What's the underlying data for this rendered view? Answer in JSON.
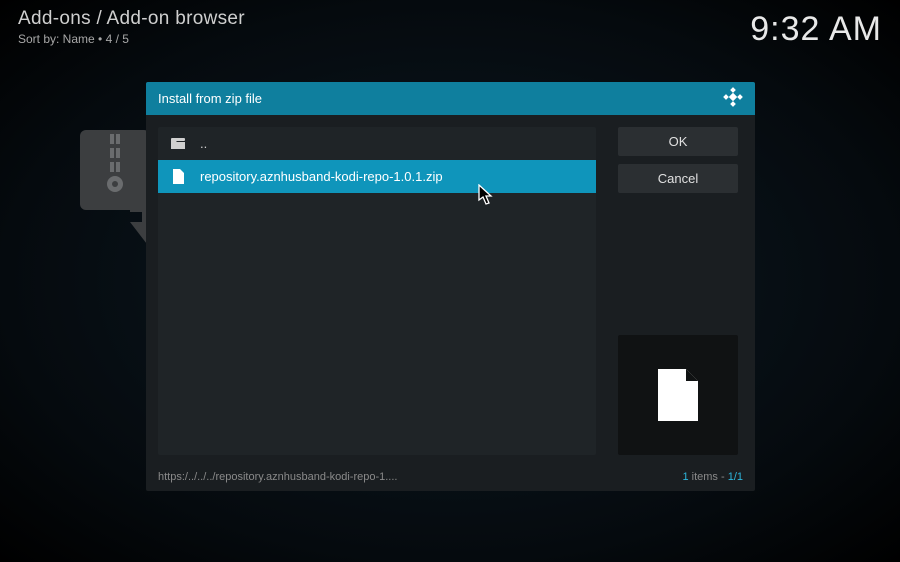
{
  "breadcrumb": "Add-ons / Add-on browser",
  "sortline": "Sort by: Name   •   4 / 5",
  "clock": "9:32 AM",
  "dialog": {
    "title": "Install from zip file",
    "rows": {
      "parent": "..",
      "selected": "repository.aznhusband-kodi-repo-1.0.1.zip"
    },
    "buttons": {
      "ok": "OK",
      "cancel": "Cancel"
    },
    "footer": {
      "path": "https:/../../../repository.aznhusband-kodi-repo-1....",
      "count_num": "1",
      "count_word": " items - ",
      "count_frac": "1/1"
    }
  }
}
